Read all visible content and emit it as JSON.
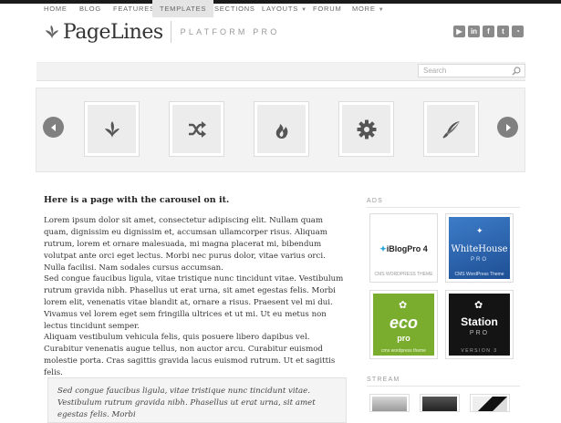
{
  "header": {
    "logo_text": "PageLines",
    "tagline": "PLATFORM PRO",
    "social_icons": [
      "youtube-icon",
      "linkedin-icon",
      "facebook-icon",
      "twitter-icon",
      "rss-icon"
    ]
  },
  "nav": {
    "items": [
      {
        "label": "HOME"
      },
      {
        "label": "BLOG"
      },
      {
        "label": "FEATURES"
      },
      {
        "label": "TEMPLATES",
        "active": true
      },
      {
        "label": "SECTIONS"
      },
      {
        "label": "LAYOUTS"
      },
      {
        "label": "FORUM"
      },
      {
        "label": "MORE"
      }
    ],
    "search_placeholder": "Search"
  },
  "carousel": {
    "icons": [
      "leaf-icon",
      "shuffle-icon",
      "flame-icon",
      "gear-icon",
      "quill-icon"
    ]
  },
  "content": {
    "heading": "Here is a page with the carousel on it.",
    "paragraphs": [
      "Lorem ipsum dolor sit amet, consectetur adipiscing elit. Nullam quam quam, dignissim eu dignissim et, accumsan ullamcorper risus. Aliquam rutrum, lorem et ornare malesuada, mi magna placerat mi, bibendum volutpat ante orci eget lectus. Morbi nec purus dolor, vitae varius orci. Nulla facilisi. Nam sodales cursus accumsan.",
      "Sed congue faucibus ligula, vitae tristique nunc tincidunt vitae. Vestibulum rutrum gravida nibh. Phasellus ut erat urna, sit amet egestas felis. Morbi lorem elit, venenatis vitae blandit at, ornare a risus. Praesent vel mi dui. Vivamus vel lorem eget sem fringilla ultrices et ut mi. Ut eu metus non lectus tincidunt semper.",
      "Aliquam vestibulum vehicula felis, quis posuere libero dapibus vel. Curabitur venenatis augue tellus, non auctor arcu. Curabitur euismod molestie porta. Cras sagittis gravida lacus euismod rutrum. Ut et sagittis felis."
    ],
    "quote": "Sed congue faucibus ligula, vitae tristique nunc tincidunt vitae. Vestibulum rutrum gravida nibh. Phasellus ut erat urna, sit amet egestas felis. Morbi"
  },
  "sidebar": {
    "ads_label": "ADS",
    "ads": [
      {
        "title": "iBlogPro 4",
        "sub": "CMS WORDPRESS THEME",
        "color": "#ffffff"
      },
      {
        "title": "WhiteHouse",
        "title2": "PRO",
        "sub": "CMS WordPress Theme",
        "color": "#2a5fa8"
      },
      {
        "title": "eco",
        "title2": "pro",
        "sub": "cms wordpress theme",
        "color": "#7aad2e"
      },
      {
        "title": "Station",
        "title2": "PRO",
        "sub": "VERSION 3",
        "color": "#141414"
      }
    ],
    "stream_label": "STREAM"
  }
}
